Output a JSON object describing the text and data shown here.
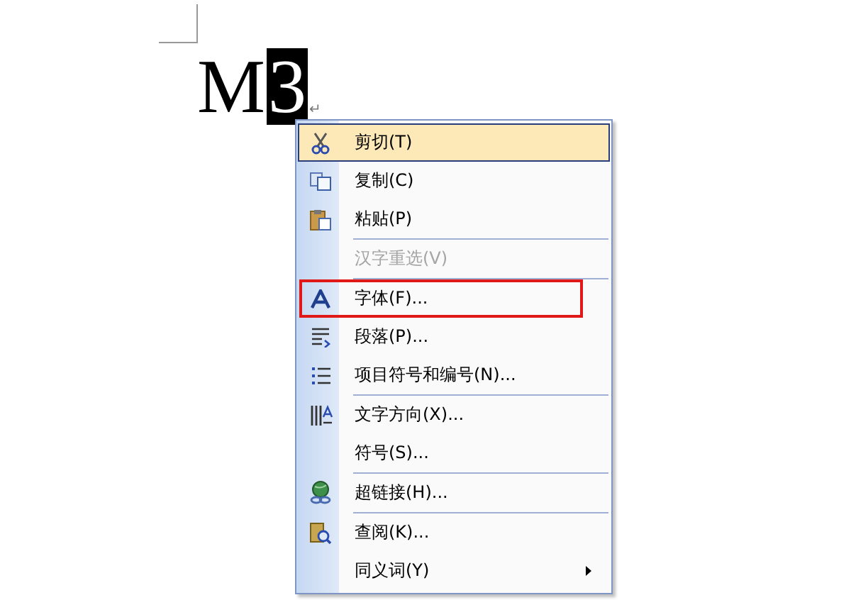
{
  "document": {
    "runs": [
      {
        "text": "M",
        "selected": false
      },
      {
        "text": "3",
        "selected": true
      }
    ],
    "paragraph_mark": "↵"
  },
  "context_menu": {
    "items": [
      {
        "kind": "item",
        "label": "剪切(T)",
        "selected": true,
        "disabled": false,
        "submenu": false,
        "marked": false
      },
      {
        "kind": "item",
        "label": "复制(C)",
        "selected": false,
        "disabled": false,
        "submenu": false,
        "marked": false
      },
      {
        "kind": "item",
        "label": "粘贴(P)",
        "selected": false,
        "disabled": false,
        "submenu": false,
        "marked": false
      },
      {
        "kind": "separator"
      },
      {
        "kind": "item",
        "label": "汉字重选(V)",
        "selected": false,
        "disabled": true,
        "submenu": false,
        "marked": false
      },
      {
        "kind": "separator"
      },
      {
        "kind": "item",
        "label": "字体(F)...",
        "selected": false,
        "disabled": false,
        "submenu": false,
        "marked": true
      },
      {
        "kind": "item",
        "label": "段落(P)...",
        "selected": false,
        "disabled": false,
        "submenu": false,
        "marked": false
      },
      {
        "kind": "item",
        "label": "项目符号和编号(N)...",
        "selected": false,
        "disabled": false,
        "submenu": false,
        "marked": false
      },
      {
        "kind": "separator"
      },
      {
        "kind": "item",
        "label": "文字方向(X)...",
        "selected": false,
        "disabled": false,
        "submenu": false,
        "marked": false
      },
      {
        "kind": "item",
        "label": "符号(S)...",
        "selected": false,
        "disabled": false,
        "submenu": false,
        "marked": false
      },
      {
        "kind": "separator"
      },
      {
        "kind": "item",
        "label": "超链接(H)...",
        "selected": false,
        "disabled": false,
        "submenu": false,
        "marked": false
      },
      {
        "kind": "separator"
      },
      {
        "kind": "item",
        "label": "查阅(K)...",
        "selected": false,
        "disabled": false,
        "submenu": false,
        "marked": false
      },
      {
        "kind": "item",
        "label": "同义词(Y)",
        "selected": false,
        "disabled": false,
        "submenu": true,
        "marked": false
      }
    ]
  }
}
